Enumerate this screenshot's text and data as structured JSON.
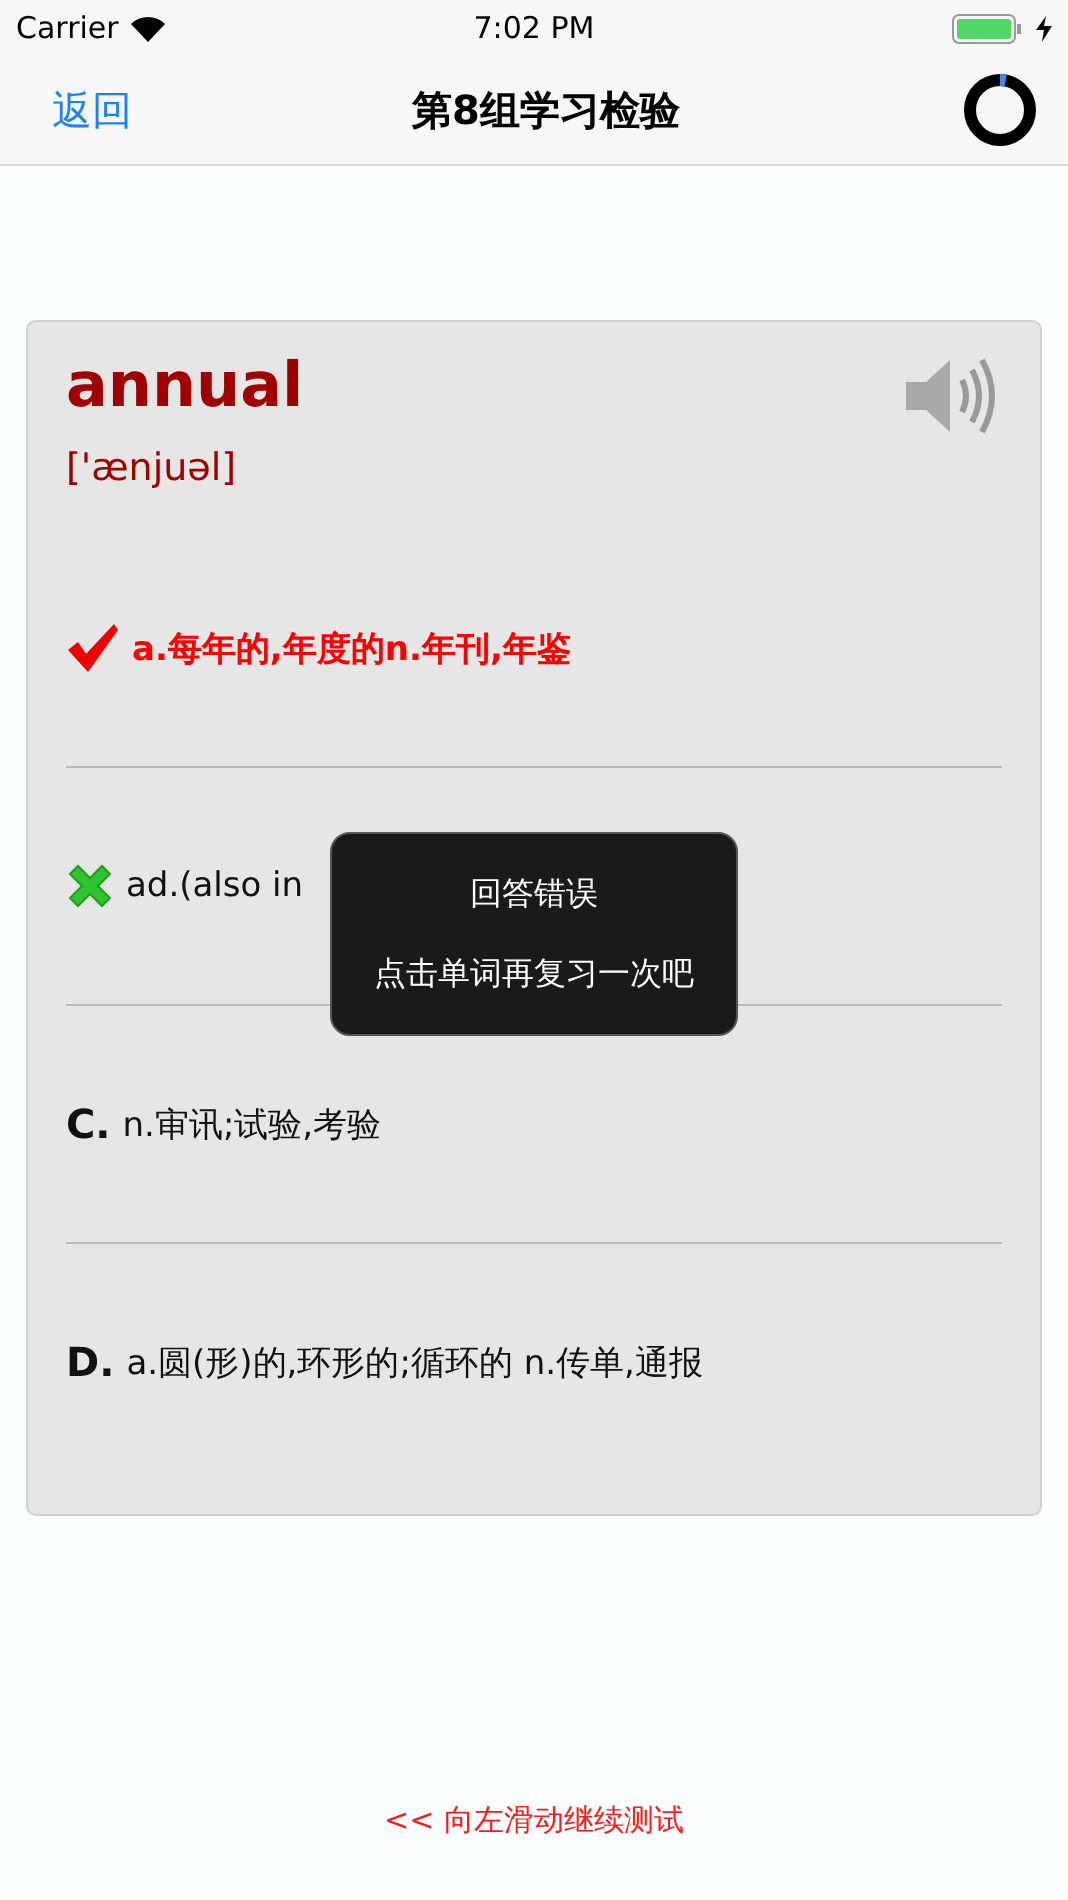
{
  "status_bar": {
    "carrier": "Carrier",
    "time": "7:02 PM"
  },
  "nav": {
    "back": "返回",
    "title": "第8组学习检验",
    "progress": {
      "level": 0.03
    }
  },
  "card": {
    "word": "annual",
    "phonetic": "['ænjuəl]",
    "options": [
      {
        "kind": "correct",
        "text": "a.每年的,年度的n.年刊,年鉴"
      },
      {
        "kind": "wrong",
        "text": "ad.(also in"
      },
      {
        "kind": "plain",
        "marker": "C.",
        "text": "n.审讯;试验,考验"
      },
      {
        "kind": "plain",
        "marker": "D.",
        "text": "a.圆(形)的,环形的;循环的 n.传单,通报"
      }
    ]
  },
  "toast": {
    "title": "回答错误",
    "message": "点击单词再复习一次吧"
  },
  "hint": "<< 向左滑动继续测试"
}
